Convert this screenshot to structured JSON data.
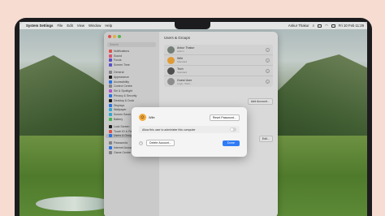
{
  "menubar": {
    "app_name": "System Settings",
    "menus": [
      "File",
      "Edit",
      "View",
      "Window",
      "Help"
    ],
    "user": "Ankur Thakur",
    "datetime": "Fri 10 Feb 11:29"
  },
  "sidebar": {
    "search_placeholder": "Search",
    "items": [
      {
        "label": "Notifications",
        "color": "#ef5a54"
      },
      {
        "label": "Sound",
        "color": "#ee5a7c"
      },
      {
        "label": "Focus",
        "color": "#6257d8"
      },
      {
        "label": "Screen Time",
        "color": "#6257d8"
      },
      {
        "label": "General",
        "color": "#8e8e93"
      },
      {
        "label": "Appearance",
        "color": "#222222"
      },
      {
        "label": "Accessibility",
        "color": "#2f7cf6"
      },
      {
        "label": "Control Centre",
        "color": "#8e8e93"
      },
      {
        "label": "Siri & Spotlight",
        "color": "#c45bd8"
      },
      {
        "label": "Privacy & Security",
        "color": "#2f7cf6"
      },
      {
        "label": "Desktop & Dock",
        "color": "#222222"
      },
      {
        "label": "Displays",
        "color": "#2f7cf6"
      },
      {
        "label": "Wallpaper",
        "color": "#38b6e0"
      },
      {
        "label": "Screen Saver",
        "color": "#38b6e0"
      },
      {
        "label": "Battery",
        "color": "#4ac45a"
      },
      {
        "label": "Lock Screen",
        "color": "#222222"
      },
      {
        "label": "Touch ID & Password",
        "color": "#ef5a54"
      },
      {
        "label": "Users & Groups",
        "color": "#2f7cf6"
      },
      {
        "label": "Passwords",
        "color": "#8e8e93"
      },
      {
        "label": "Internet Accounts",
        "color": "#2f7cf6"
      },
      {
        "label": "Game Centre",
        "color": "#8e8e93"
      }
    ],
    "selected_index": 17
  },
  "content": {
    "title": "Users & Groups",
    "users": [
      {
        "name": "Ankur Thakur",
        "role": "Admin",
        "avatar_color": "#7d8a82"
      },
      {
        "name": "Wife",
        "role": "Standard",
        "avatar_color": "#f3a93b"
      },
      {
        "name": "Tech",
        "role": "Standard",
        "avatar_color": "#555555"
      },
      {
        "name": "Guest User",
        "role": "Login, Shari...",
        "avatar_color": "#9a9a9a"
      }
    ],
    "add_account": "Add Account...",
    "edit": "Edit..."
  },
  "sheet": {
    "user_name": "Wife",
    "reset_password": "Reset Password...",
    "admin_toggle_label": "Allow this user to administer this computer",
    "admin_enabled": false,
    "help": "?",
    "delete_account": "Delete Account...",
    "done": "Done"
  }
}
